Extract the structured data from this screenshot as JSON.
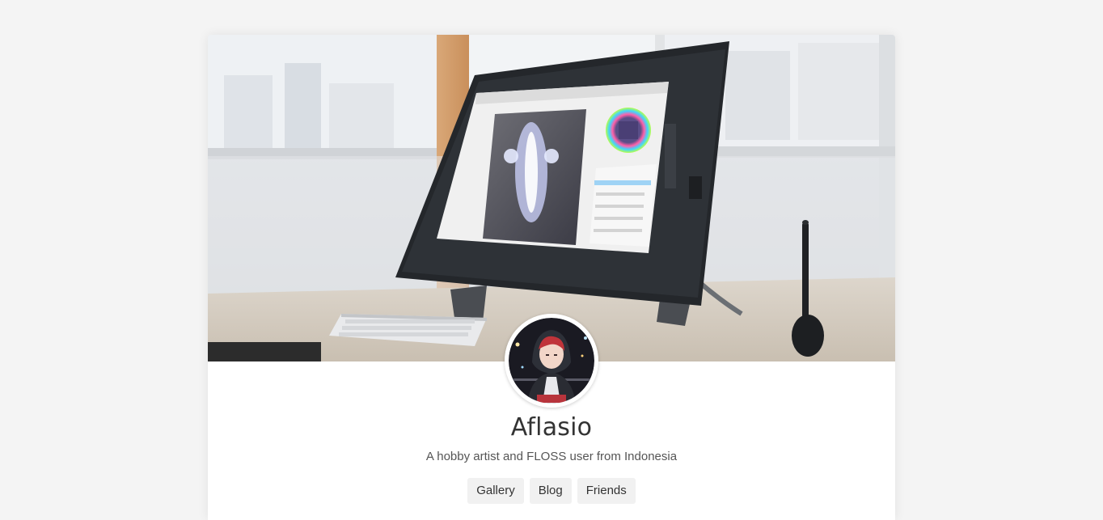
{
  "profile": {
    "name": "Aflasio",
    "bio": "A hobby artist and FLOSS user from Indonesia"
  },
  "nav": {
    "links": [
      {
        "label": "Gallery"
      },
      {
        "label": "Blog"
      },
      {
        "label": "Friends"
      }
    ]
  },
  "images": {
    "cover": "cover-photo-drawing-tablet",
    "avatar": "avatar-anime-character"
  },
  "colors": {
    "page_background": "#f4f4f4",
    "card_background": "#ffffff",
    "button_background": "#f1f1f1",
    "text_primary": "#333333",
    "text_secondary": "#555555"
  }
}
